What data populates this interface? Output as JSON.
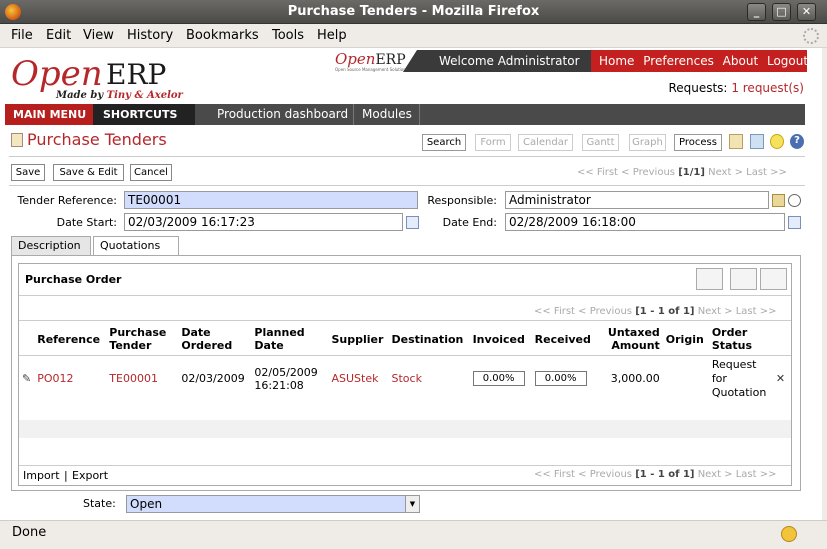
{
  "window": {
    "title": "Purchase Tenders - Mozilla Firefox"
  },
  "menubar": {
    "items": [
      "File",
      "Edit",
      "View",
      "History",
      "Bookmarks",
      "Tools",
      "Help"
    ]
  },
  "header": {
    "logo_open": "Open",
    "logo_erp": "ERP",
    "logo_made_prefix": "Made by ",
    "logo_made_names": "Tiny & Axelor",
    "mini_logo_open": "Open",
    "mini_logo_erp": "ERP",
    "mini_logo_sub": "Open Source Management Solution",
    "welcome": "Welcome Administrator",
    "links": [
      "Home",
      "Preferences",
      "About",
      "Logout"
    ],
    "requests_label": "Requests:",
    "requests_value": "1 request(s)"
  },
  "nav": {
    "main_menu": "MAIN MENU",
    "shortcuts": "SHORTCUTS",
    "items": [
      "Production dashboard",
      "Modules"
    ]
  },
  "page": {
    "title": "Purchase Tenders",
    "view_buttons": [
      "Search",
      "Form",
      "Calendar",
      "Gantt",
      "Graph",
      "Process"
    ]
  },
  "toolbar": {
    "save": "Save",
    "save_edit": "Save & Edit",
    "cancel": "Cancel",
    "pager_first": "<< First",
    "pager_prev": "< Previous",
    "pager_count": "[1/1]",
    "pager_next": "Next >",
    "pager_last": "Last >>"
  },
  "form": {
    "tender_ref_label": "Tender Reference:",
    "tender_ref": "TE00001",
    "responsible_label": "Responsible:",
    "responsible": "Administrator",
    "date_start_label": "Date Start:",
    "date_start": "02/03/2009 16:17:23",
    "date_end_label": "Date End:",
    "date_end": "02/28/2009 16:18:00",
    "state_label": "State:",
    "state": "Open"
  },
  "tabs": [
    "Description",
    "Quotations"
  ],
  "purchase_orders": {
    "title": "Purchase Order",
    "pager_first": "<< First",
    "pager_prev": "< Previous",
    "pager_count": "[1 - 1 of 1]",
    "pager_next": "Next >",
    "pager_last": "Last >>",
    "columns": {
      "reference": "Reference",
      "tender_1": "Purchase",
      "tender_2": "Tender",
      "ordered_1": "Date",
      "ordered_2": "Ordered",
      "planned_1": "Planned",
      "planned_2": "Date",
      "supplier": "Supplier",
      "destination": "Destination",
      "invoiced": "Invoiced",
      "received": "Received",
      "untaxed_1": "Untaxed",
      "untaxed_2": "Amount",
      "origin": "Origin",
      "status_1": "Order",
      "status_2": "Status"
    },
    "row": {
      "reference": "PO012",
      "tender": "TE00001",
      "date_ordered": "02/03/2009",
      "planned_1": "02/05/2009",
      "planned_2": "16:21:08",
      "supplier": "ASUStek",
      "destination": "Stock",
      "invoiced": "0.00%",
      "received": "0.00%",
      "untaxed": "3,000.00",
      "origin": "",
      "status_1": "Request",
      "status_2": "for",
      "status_3": "Quotation"
    },
    "import": "Import",
    "sep": "|",
    "export": "Export"
  },
  "status": {
    "text": "Done"
  },
  "colors": {
    "accent": "#b5272b",
    "required_field": "#d2dcfc"
  }
}
